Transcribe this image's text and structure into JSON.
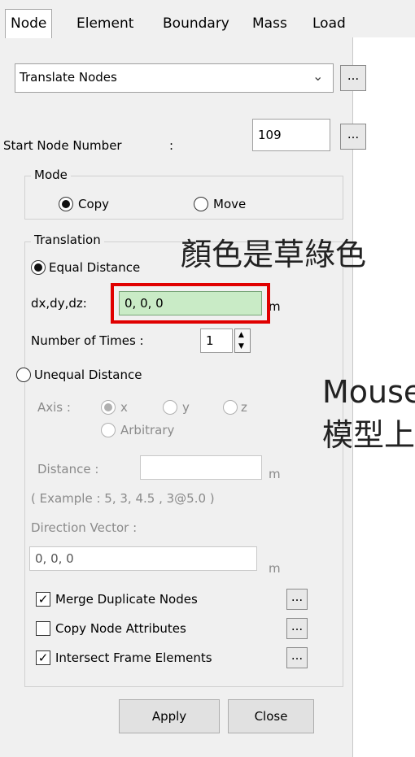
{
  "tabs": [
    "Node",
    "Element",
    "Boundary",
    "Mass",
    "Load"
  ],
  "function_select": {
    "value": "Translate Nodes"
  },
  "start_node": {
    "label": "Start Node Number",
    "colon": ":",
    "value": "109"
  },
  "mode": {
    "title": "Mode",
    "copy_label": "Copy",
    "move_label": "Move",
    "selected": "Copy"
  },
  "translation": {
    "title": "Translation",
    "equal_distance_label": "Equal Distance",
    "dxdydz_label": "dx,dy,dz:",
    "dxdydz_value": "0, 0, 0",
    "dxdydz_unit": "m",
    "times_label": "Number of Times :",
    "times_value": "1",
    "unequal_distance_label": "Unequal Distance",
    "axis_label": "Axis :",
    "axis_x": "x",
    "axis_y": "y",
    "axis_z": "z",
    "axis_arbitrary": "Arbitrary",
    "distance_label": "Distance  :",
    "distance_unit": "m",
    "example": "( Example :  5, 3, 4.5 , 3@5.0 )",
    "direction_label": "Direction Vector :",
    "direction_value": "0, 0, 0",
    "direction_unit": "m"
  },
  "options": [
    {
      "label": "Merge Duplicate Nodes",
      "checked": true
    },
    {
      "label": "Copy Node Attributes",
      "checked": false
    },
    {
      "label": "Intersect Frame Elements",
      "checked": true
    }
  ],
  "more_button": "...",
  "buttons": {
    "apply": "Apply",
    "close": "Close"
  },
  "annotations": {
    "green_note": "顏色是草綠色",
    "mouse_note_line1": "Mouse",
    "mouse_note_line2": "模型上"
  },
  "colors": {
    "highlight_field": "#c9ebc6",
    "annotation_box": "#e00000"
  }
}
